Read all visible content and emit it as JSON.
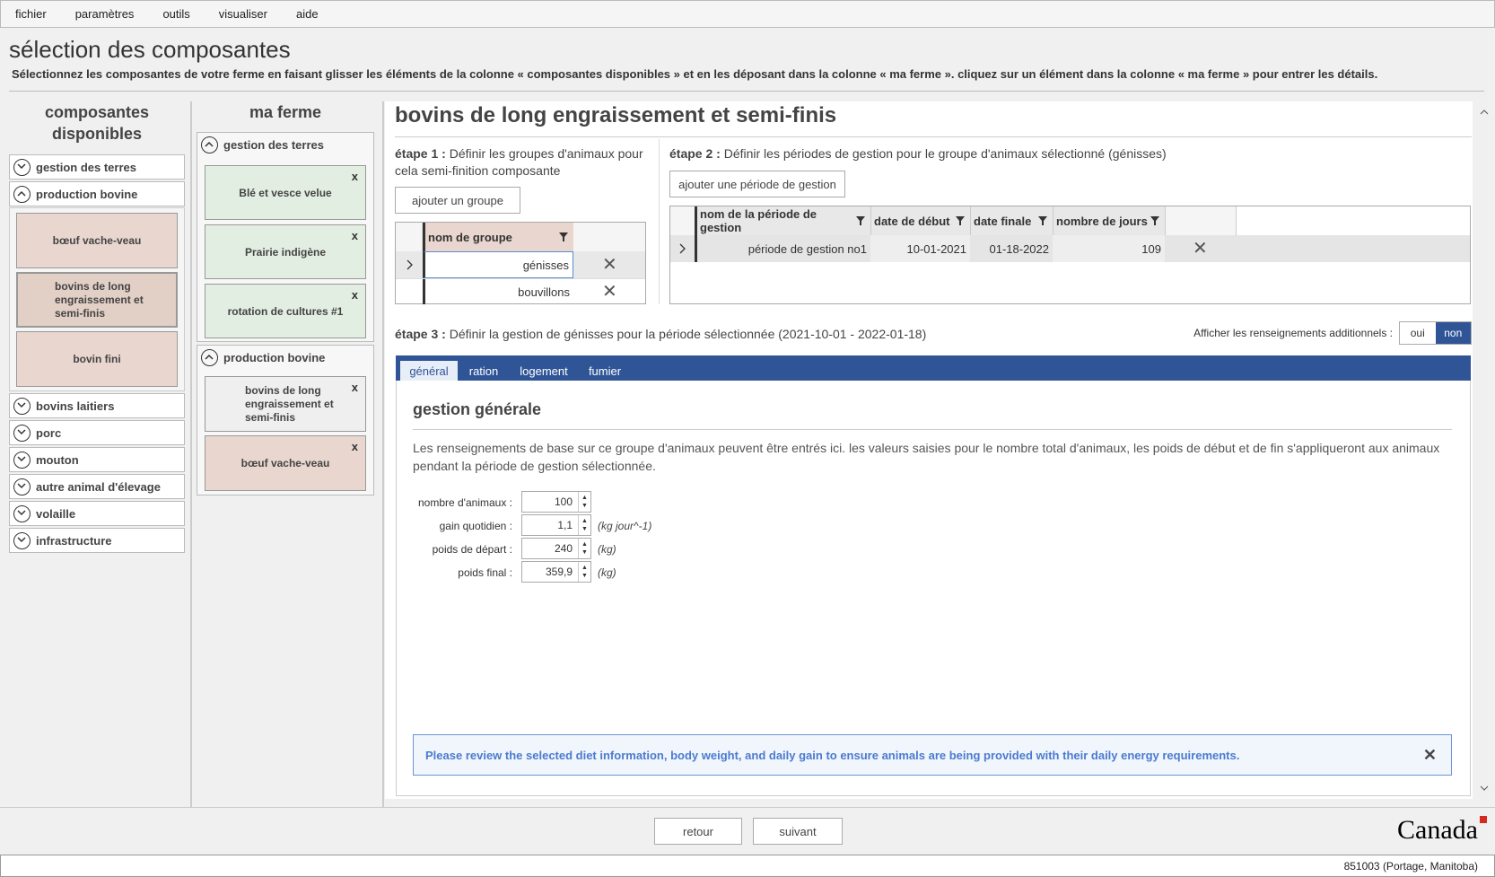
{
  "menu": [
    "fichier",
    "paramètres",
    "outils",
    "visualiser",
    "aide"
  ],
  "page": {
    "title": "sélection des composantes",
    "instructions": "Sélectionnez les composantes de votre ferme en faisant glisser les éléments de la colonne « composantes disponibles » et en les déposant dans la colonne « ma ferme ». cliquez sur un élément dans la colonne « ma ferme » pour entrer les détails."
  },
  "available": {
    "title_line1": "composantes",
    "title_line2": "disponibles",
    "categories": [
      "gestion des terres",
      "production bovine",
      "bovins laitiers",
      "porc",
      "mouton",
      "autre animal d'élevage",
      "volaille",
      "infrastructure"
    ],
    "bovine_items": [
      "bœuf vache-veau",
      "bovins de long engraissement et semi-finis",
      "bovin fini"
    ]
  },
  "farm": {
    "title": "ma ferme",
    "land_group": "gestion des terres",
    "land_items": [
      "Blé et vesce velue",
      "Prairie indigène",
      "rotation de cultures #1"
    ],
    "bovine_group": "production bovine",
    "bovine_items": [
      "bovins de long engraissement et semi-finis",
      "bœuf vache-veau"
    ]
  },
  "main": {
    "title": "bovins de long engraissement et semi-finis",
    "step1": {
      "label": "étape 1 :",
      "text_line1": "Définir les groupes d'animaux pour",
      "text_line2": "cela semi-finition composante",
      "button": "ajouter un groupe",
      "column": "nom de groupe",
      "rows": [
        "génisses",
        "bouvillons"
      ]
    },
    "step2": {
      "label": "étape 2 :",
      "text": "Définir les périodes de gestion pour le groupe d'animaux sélectionné (génisses)",
      "button": "ajouter une période de gestion",
      "columns": [
        "nom de la période de gestion",
        "date de début",
        "date finale",
        "nombre de jours"
      ],
      "row": [
        "période de gestion no1",
        "10-01-2021",
        "01-18-2022",
        "109"
      ]
    },
    "step3": {
      "label": "étape 3 :",
      "text": "Définir la gestion de génisses pour la période sélectionnée (2021-10-01 - 2022-01-18)"
    },
    "additional": {
      "label": "Afficher les renseignements additionnels :",
      "yes": "oui",
      "no": "non"
    },
    "tabs": [
      "général",
      "ration",
      "logement",
      "fumier"
    ],
    "section_title": "gestion générale",
    "description_line1": "Les renseignements de base sur ce groupe d'animaux peuvent être entrés ici. les valeurs saisies pour le nombre total d'animaux, les poids de début et de fin s'appliqueront aux animaux",
    "description_line2": "pendant la période de gestion sélectionnée.",
    "fields": [
      {
        "label": "nombre d'animaux :",
        "value": "100",
        "unit": ""
      },
      {
        "label": "gain quotidien :",
        "value": "1,1",
        "unit": "(kg jour^-1)"
      },
      {
        "label": "poids de départ :",
        "value": "240",
        "unit": "(kg)"
      },
      {
        "label": "poids final :",
        "value": "359,9",
        "unit": "(kg)"
      }
    ],
    "alert": "Please review the selected diet information, body weight, and daily gain to ensure animals are being provided with their daily energy requirements."
  },
  "footer": {
    "back": "retour",
    "next": "suivant",
    "wordmark": "Canada"
  },
  "status": "851003 (Portage, Manitoba)",
  "colors": {
    "accent": "#2f5597",
    "alert_text": "#4a7bd0",
    "card_brown": "#e8d6cf",
    "card_green": "#e3eee3"
  }
}
